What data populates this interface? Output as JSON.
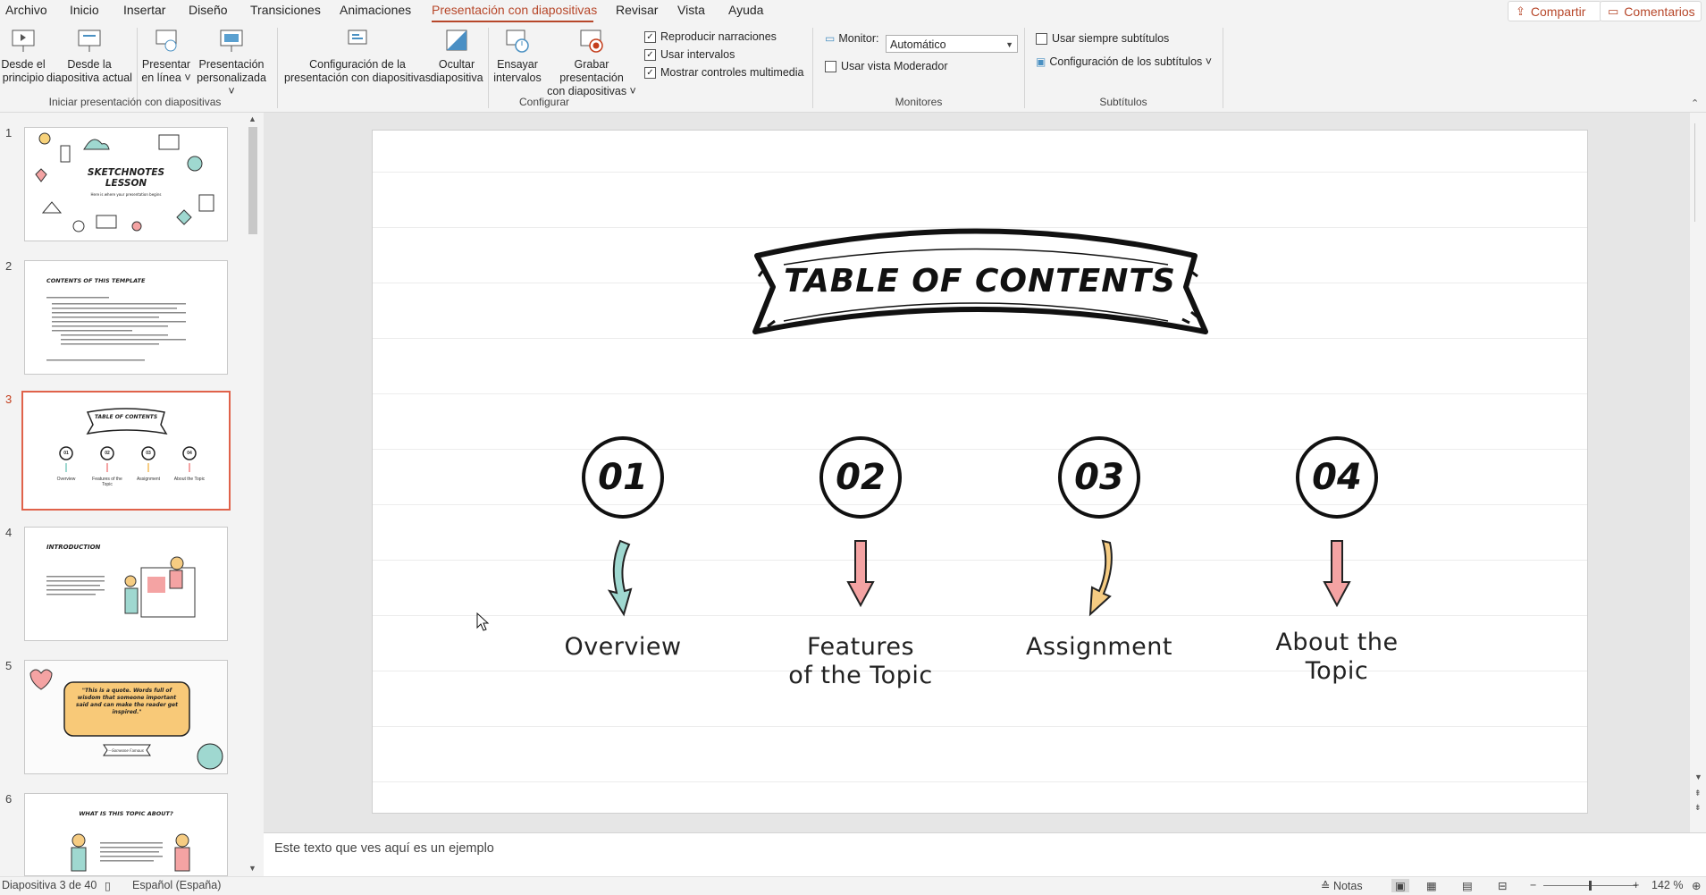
{
  "menu": {
    "items": [
      "Archivo",
      "Inicio",
      "Insertar",
      "Diseño",
      "Transiciones",
      "Animaciones",
      "Presentación con diapositivas",
      "Revisar",
      "Vista",
      "Ayuda"
    ],
    "active": "Presentación con diapositivas",
    "share_label": "Compartir",
    "comments_label": "Comentarios"
  },
  "ribbon": {
    "from_beginning": [
      "Desde el",
      "principio"
    ],
    "from_current": [
      "Desde la",
      "diapositiva actual"
    ],
    "present_online": [
      "Presentar",
      "en línea ˅"
    ],
    "custom_show": [
      "Presentación",
      "personalizada ˅"
    ],
    "group_start": "Iniciar presentación con diapositivas",
    "setup_show": [
      "Configuración de la",
      "presentación con diapositivas"
    ],
    "hide_slide": [
      "Ocultar",
      "diapositiva"
    ],
    "rehearse": [
      "Ensayar",
      "intervalos"
    ],
    "record": [
      "Grabar presentación",
      "con diapositivas ˅"
    ],
    "check_narrations": "Reproducir narraciones",
    "check_timings": "Usar intervalos",
    "check_media": "Mostrar controles multimedia",
    "group_setup": "Configurar",
    "monitor_label": "Monitor:",
    "monitor_value": "Automático",
    "presenter_view": "Usar vista Moderador",
    "group_monitors": "Monitores",
    "always_subtitles": "Usar siempre subtítulos",
    "subtitle_settings": "Configuración de los subtítulos ˅",
    "group_subtitles": "Subtítulos"
  },
  "thumbnails": [
    {
      "num": "1",
      "title": "SKETCHNOTES LESSON",
      "subtitle": "Here is where your presentation begins"
    },
    {
      "num": "2",
      "title": "CONTENTS OF THIS TEMPLATE"
    },
    {
      "num": "3",
      "title": "TABLE OF CONTENTS",
      "labels": [
        "Overview",
        "Features of the Topic",
        "Assignment",
        "About the Topic"
      ],
      "nums": [
        "01",
        "02",
        "03",
        "04"
      ]
    },
    {
      "num": "4",
      "title": "INTRODUCTION"
    },
    {
      "num": "5",
      "title": "\"This is a quote. Words full of wisdom that someone important said and can make the reader get inspired.\"",
      "caption": "—Someone Famous"
    },
    {
      "num": "6",
      "title": "WHAT IS THIS TOPIC ABOUT?"
    }
  ],
  "slide": {
    "title": "TABLE OF CONTENTS",
    "items": [
      {
        "num": "01",
        "label_1": "Overview",
        "label_2": ""
      },
      {
        "num": "02",
        "label_1": "Features",
        "label_2": "of the Topic"
      },
      {
        "num": "03",
        "label_1": "Assignment",
        "label_2": ""
      },
      {
        "num": "04",
        "label_1": "About the",
        "label_2": "Topic"
      }
    ],
    "arrow_colors": [
      "#9fd8d0",
      "#f4a3a3",
      "#f6cc82",
      "#f4a3a3"
    ]
  },
  "notes": {
    "text": "Este texto que ves aquí es un ejemplo"
  },
  "status": {
    "slide_info": "Diapositiva 3 de 40",
    "language": "Español (España)",
    "notes_label": "Notas",
    "zoom": "142 %"
  },
  "colors": {
    "accent": "#b7472a",
    "selected_thumb": "#e0624a"
  }
}
